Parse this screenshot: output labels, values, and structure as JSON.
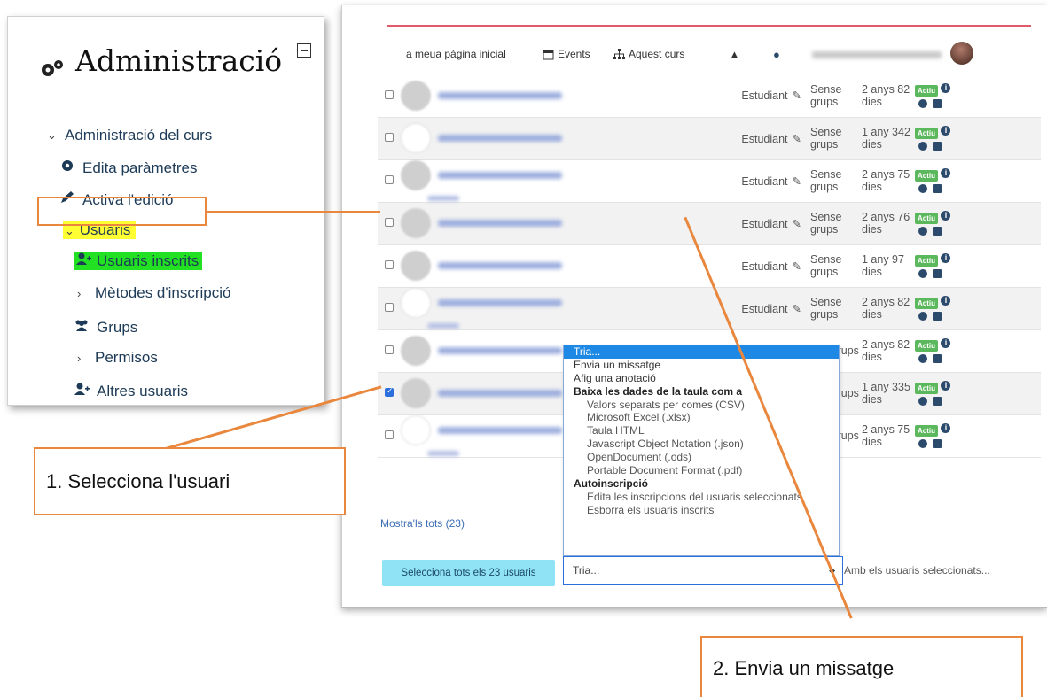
{
  "admin": {
    "title": "Administració",
    "items": [
      {
        "label": "Administració del curs",
        "icon": "chevron-down-icon"
      },
      {
        "label": "Edita paràmetres",
        "icon": "gear-icon"
      },
      {
        "label": "Activa l'edició",
        "icon": "pencil-icon"
      },
      {
        "label": "Usuaris",
        "icon": "chevron-down-icon"
      },
      {
        "label": "Usuaris inscrits",
        "icon": "user-plus-icon"
      },
      {
        "label": "Mètodes d'inscripció",
        "icon": "chevron-right-icon"
      },
      {
        "label": "Grups",
        "icon": "users-icon"
      },
      {
        "label": "Permisos",
        "icon": "chevron-right-icon"
      },
      {
        "label": "Altres usuaris",
        "icon": "user-plus-icon"
      }
    ]
  },
  "navbar": {
    "home": "a meua pàgina inicial",
    "events": "Events",
    "course": "Aquest curs"
  },
  "table": {
    "rows": [
      {
        "role": "Estudiant",
        "groups": "Sense grups",
        "time": "2 anys 82 dies",
        "status": "Actiu",
        "checked": false
      },
      {
        "role": "Estudiant",
        "groups": "Sense grups",
        "time": "1 any 342 dies",
        "status": "Actiu",
        "checked": false
      },
      {
        "role": "Estudiant",
        "groups": "Sense grups",
        "time": "2 anys 75 dies",
        "status": "Actiu",
        "checked": false
      },
      {
        "role": "Estudiant",
        "groups": "Sense grups",
        "time": "2 anys 76 dies",
        "status": "Actiu",
        "checked": false
      },
      {
        "role": "Estudiant",
        "groups": "Sense grups",
        "time": "1 any 97 dies",
        "status": "Actiu",
        "checked": false
      },
      {
        "role": "Estudiant",
        "groups": "Sense grups",
        "time": "2 anys 82 dies",
        "status": "Actiu",
        "checked": false
      },
      {
        "role": "",
        "groups": "ense rups",
        "time": "2 anys 82 dies",
        "status": "Actiu",
        "checked": false
      },
      {
        "role": "",
        "groups": "ense rups",
        "time": "1 any 335 dies",
        "status": "Actiu",
        "checked": true
      },
      {
        "role": "",
        "groups": "ense rups",
        "time": "2 anys 75 dies",
        "status": "Actiu",
        "checked": false
      }
    ]
  },
  "dropdown": {
    "options": [
      {
        "label": "Tria...",
        "type": "sel"
      },
      {
        "label": "Envia un missatge",
        "type": "item"
      },
      {
        "label": "Afig una anotació",
        "type": "item"
      },
      {
        "label": "Baixa les dades de la taula com a",
        "type": "group"
      },
      {
        "label": "Valors separats per comes (CSV)",
        "type": "sub"
      },
      {
        "label": "Microsoft Excel (.xlsx)",
        "type": "sub"
      },
      {
        "label": "Taula HTML",
        "type": "sub"
      },
      {
        "label": "Javascript Object Notation (.json)",
        "type": "sub"
      },
      {
        "label": "OpenDocument (.ods)",
        "type": "sub"
      },
      {
        "label": "Portable Document Format (.pdf)",
        "type": "sub"
      },
      {
        "label": "Autoinscripció",
        "type": "group"
      },
      {
        "label": "Edita les inscripcions del usuaris seleccionats",
        "type": "sub"
      },
      {
        "label": "Esborra els usuaris inscrits",
        "type": "sub"
      }
    ],
    "selected": "Tria...",
    "with_users": "Amb els usuaris seleccionats..."
  },
  "footer": {
    "show_all": "Mostra'ls tots (23)",
    "select_all": "Selecciona tots els 23 usuaris"
  },
  "callouts": {
    "one": "1. Selecciona l'usuari",
    "two": "2. Envia un missatge"
  },
  "colors": {
    "accent": "#e8873d",
    "highlight_yellow": "#ffff33",
    "highlight_green": "#22e022",
    "status_green": "#5cb85c",
    "select_blue": "#1e88e5"
  }
}
